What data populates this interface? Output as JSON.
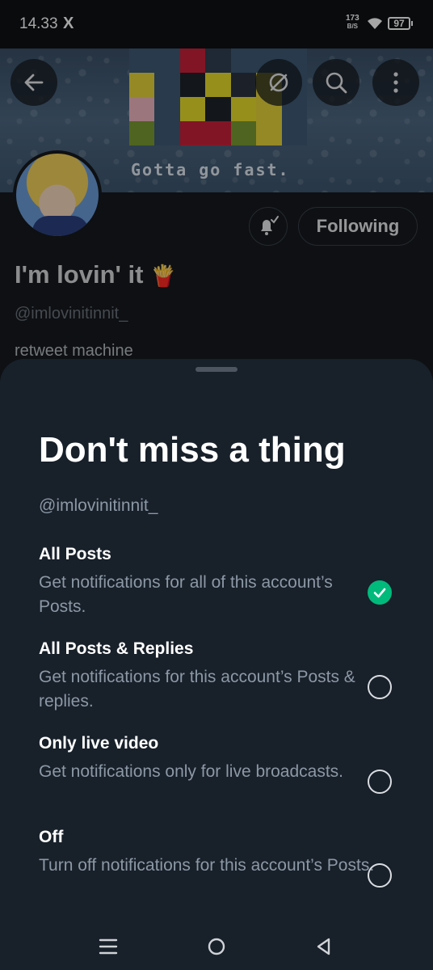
{
  "status_bar": {
    "time": "14.33",
    "app_icon": "X",
    "net_speed_value": "173",
    "net_speed_unit": "B/S",
    "battery": "97"
  },
  "profile": {
    "banner_caption": "Gotta go fast.",
    "display_name": "I'm lovin' it",
    "name_emoji": "🍟",
    "handle": "@imlovinitinnit_",
    "bio": "retweet machine",
    "following_label": "Following"
  },
  "sheet": {
    "title": "Don't miss a thing",
    "handle": "@imlovinitinnit_",
    "options": [
      {
        "title": "All Posts",
        "description": "Get notifications for all of this account’s Posts.",
        "selected": true
      },
      {
        "title": "All Posts & Replies",
        "description": "Get notifications for this account’s Posts & replies.",
        "selected": false
      },
      {
        "title": "Only live video",
        "description": "Get notifications only for live broadcasts.",
        "selected": false
      },
      {
        "title": "Off",
        "description": "Turn off notifications for this account’s Posts.",
        "selected": false
      }
    ]
  },
  "colors": {
    "accent_green": "#00ba7c",
    "sheet_background": "#18202a"
  },
  "icons": [
    "back-arrow-icon",
    "grok-icon",
    "search-icon",
    "more-vertical-icon",
    "bell-check-icon",
    "checkmark-icon",
    "menu-icon",
    "home-circle-icon",
    "back-triangle-icon",
    "wifi-icon",
    "battery-icon"
  ]
}
